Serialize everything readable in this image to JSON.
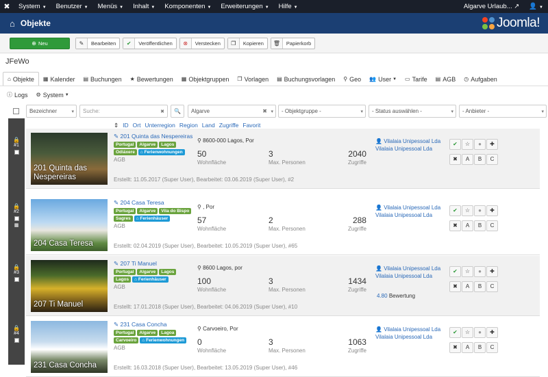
{
  "topbar": {
    "menus": [
      "System",
      "Benutzer",
      "Menüs",
      "Inhalt",
      "Komponenten",
      "Erweiterungen",
      "Hilfe"
    ],
    "site": "Algarve Urlaub...",
    "user_icon": "user-icon"
  },
  "header": {
    "title": "Objekte",
    "brand": "Joomla!"
  },
  "toolbar": {
    "new": "Neu",
    "edit": "Bearbeiten",
    "publish": "Veröffentlichen",
    "hide": "Verstecken",
    "copy": "Kopieren",
    "trash": "Papierkorb"
  },
  "component": "JFeWo",
  "nav": {
    "row1": [
      "Objekte",
      "Kalender",
      "Buchungen",
      "Bewertungen",
      "Objektgruppen",
      "Vorlagen",
      "Buchungsvorlagen",
      "Geo",
      "User",
      "Tarife",
      "AGB",
      "Aufgaben"
    ],
    "row2": [
      "Logs",
      "System"
    ]
  },
  "filters": {
    "bezeichner": "Bezeichner",
    "search_placeholder": "Suche:",
    "region": "Algarve",
    "objektgruppe": "- Objektgruppe -",
    "status": "- Status auswählen -",
    "anbieter": "- Anbieter -"
  },
  "sort_links": [
    "ID",
    "Ort",
    "Unterregion",
    "Region",
    "Land",
    "Zugriffe",
    "Favorit"
  ],
  "labels": {
    "wohnflaeche": "Wohnfläche",
    "personen": "Max. Personen",
    "zugriffe": "Zugriffe",
    "agb": "AGB",
    "bewertung": "Bewertung"
  },
  "items": [
    {
      "num": "#1",
      "photo_caption": "201 Quinta das Nespereiras",
      "title": "201 Quinta das Nespereiras",
      "tags": [
        "Portugal",
        "Algarve",
        "Lagos",
        "Odiáxere"
      ],
      "type": "Ferienwohnungen",
      "location": "8600-000 Lagos, Por",
      "area": "50",
      "persons": "3",
      "hits": "2040",
      "owner": [
        "Vilalaia Unipessoal Lda",
        "Vilalaia Unipessoal Lda"
      ],
      "rating": "",
      "meta": "Erstellt: 11.05.2017 (Super User), Bearbeitet: 03.06.2019 (Super User), #2"
    },
    {
      "num": "#2",
      "photo_caption": "204 Casa Teresa",
      "title": "204 Casa Teresa",
      "tags": [
        "Portugal",
        "Algarve",
        "Vila do Bispo",
        "Sagres"
      ],
      "type": "Ferienhäuser",
      "location": ", Por",
      "area": "57",
      "persons": "2",
      "hits": "288",
      "owner": [
        "Vilalaia Unipessoal Lda",
        "Vilalaia Unipessoal Lda"
      ],
      "rating": "",
      "meta": "Erstellt: 02.04.2019 (Super User), Bearbeitet: 10.05.2019 (Super User), #65"
    },
    {
      "num": "#3",
      "photo_caption": "207 Ti Manuel",
      "title": "207 Ti Manuel",
      "tags": [
        "Portugal",
        "Algarve",
        "Lagos",
        "Lagos"
      ],
      "type": "Ferienhäuser",
      "location": "8600 Lagos, por",
      "area": "100",
      "persons": "3",
      "hits": "1434",
      "owner": [
        "Vilalaia Unipessoal Lda",
        "Vilalaia Unipessoal Lda"
      ],
      "rating": "4.80",
      "meta": "Erstellt: 17.01.2018 (Super User), Bearbeitet: 04.06.2019 (Super User), #10"
    },
    {
      "num": "#4",
      "photo_caption": "231 Casa Concha",
      "title": "231 Casa Concha",
      "tags": [
        "Portugal",
        "Algarve",
        "Lagoa",
        "Carvoeiro"
      ],
      "type": "Ferienwohnungen",
      "location": "Carvoeiro, Por",
      "area": "0",
      "persons": "3",
      "hits": "1063",
      "owner": [
        "Vilalaia Unipessoal Lda",
        "Vilalaia Unipessoal Lda"
      ],
      "rating": "",
      "meta": "Erstellt: 16.03.2018 (Super User), Bearbeitet: 13.05.2019 (Super User), #46"
    }
  ],
  "action_letters": [
    "A",
    "B",
    "C"
  ],
  "colors": {
    "topbar": "#1a1f2a",
    "header": "#1b3f73",
    "new_button": "#2f9a3a",
    "tag_green": "#6aa33d",
    "tag_blue": "#1d9ad6",
    "link": "#2a69b8"
  }
}
